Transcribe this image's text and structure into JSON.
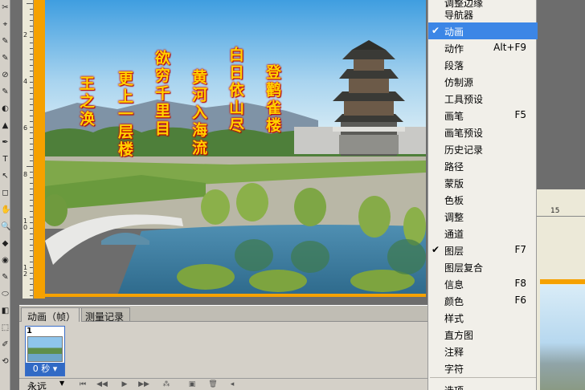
{
  "poem": {
    "columns": [
      "登鹳雀楼",
      "白日依山尽",
      "黄河入海流",
      "欲穷千里目",
      "更上一层楼",
      "王之涣"
    ]
  },
  "ruler": {
    "labels": [
      "2",
      "4",
      "6",
      "8",
      "10",
      "12"
    ],
    "right_label": "15"
  },
  "animation_panel": {
    "tabs": [
      "动画（帧）",
      "测量记录"
    ],
    "frame_number": "1",
    "frame_duration": "0 秒",
    "loop_option": "永远"
  },
  "window_menu": {
    "items": [
      {
        "label": "调整边缘",
        "shortcut": "",
        "checked": false,
        "selected": false
      },
      {
        "label": "导航器",
        "shortcut": "",
        "checked": false,
        "selected": false
      },
      {
        "label": "动画",
        "shortcut": "",
        "checked": true,
        "selected": true
      },
      {
        "label": "动作",
        "shortcut": "Alt+F9",
        "checked": false,
        "selected": false
      },
      {
        "label": "段落",
        "shortcut": "",
        "checked": false,
        "selected": false
      },
      {
        "label": "仿制源",
        "shortcut": "",
        "checked": false,
        "selected": false
      },
      {
        "label": "工具预设",
        "shortcut": "",
        "checked": false,
        "selected": false
      },
      {
        "label": "画笔",
        "shortcut": "F5",
        "checked": false,
        "selected": false
      },
      {
        "label": "画笔预设",
        "shortcut": "",
        "checked": false,
        "selected": false
      },
      {
        "label": "历史记录",
        "shortcut": "",
        "checked": false,
        "selected": false
      },
      {
        "label": "路径",
        "shortcut": "",
        "checked": false,
        "selected": false
      },
      {
        "label": "蒙版",
        "shortcut": "",
        "checked": false,
        "selected": false
      },
      {
        "label": "色板",
        "shortcut": "",
        "checked": false,
        "selected": false
      },
      {
        "label": "调整",
        "shortcut": "",
        "checked": false,
        "selected": false
      },
      {
        "label": "通道",
        "shortcut": "",
        "checked": false,
        "selected": false
      },
      {
        "label": "图层",
        "shortcut": "F7",
        "checked": true,
        "selected": false
      },
      {
        "label": "图层复合",
        "shortcut": "",
        "checked": false,
        "selected": false
      },
      {
        "label": "信息",
        "shortcut": "F8",
        "checked": false,
        "selected": false
      },
      {
        "label": "颜色",
        "shortcut": "F6",
        "checked": false,
        "selected": false
      },
      {
        "label": "样式",
        "shortcut": "",
        "checked": false,
        "selected": false
      },
      {
        "label": "直方图",
        "shortcut": "",
        "checked": false,
        "selected": false
      },
      {
        "label": "注释",
        "shortcut": "",
        "checked": false,
        "selected": false
      },
      {
        "label": "字符",
        "shortcut": "",
        "checked": false,
        "selected": false
      },
      {
        "label": "选项",
        "shortcut": "",
        "checked": false,
        "selected": false
      }
    ]
  },
  "colors": {
    "canvas_border": "#f5a100",
    "menu_highlight": "#3c86e6",
    "poem_text": "#ffd200",
    "poem_outline": "#d40000"
  }
}
